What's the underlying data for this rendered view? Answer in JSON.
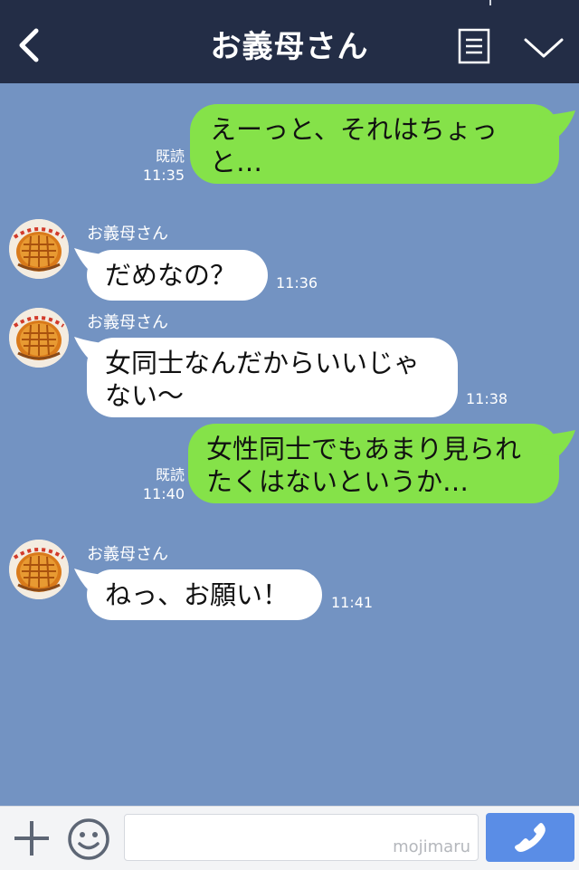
{
  "header": {
    "title": "お義母さん",
    "icons": {
      "back": "chevron-left-icon",
      "menu": "list-menu-icon",
      "more": "chevron-down-icon"
    }
  },
  "contact": {
    "name": "お義母さん",
    "avatar": "pie-avatar-icon"
  },
  "messages": [
    {
      "direction": "outgoing",
      "text": "えーっと、それはちょっと…",
      "read": "既読",
      "time": "11:35"
    },
    {
      "direction": "incoming",
      "sender": "お義母さん",
      "text": "だめなの？",
      "time": "11:36"
    },
    {
      "direction": "incoming",
      "sender": "お義母さん",
      "text": "女同士なんだからいいじゃない〜",
      "time": "11:38"
    },
    {
      "direction": "outgoing",
      "text": "女性同士でもあまり見られたくはないというか…",
      "read": "既読",
      "time": "11:40"
    },
    {
      "direction": "incoming",
      "sender": "お義母さん",
      "text": "ねっ、お願い！",
      "time": "11:41"
    }
  ],
  "input_bar": {
    "placeholder": "",
    "watermark": "mojimaru",
    "icons": {
      "add": "plus-icon",
      "emoji": "smiley-icon",
      "call": "phone-icon"
    }
  },
  "colors": {
    "header_bg": "#232d46",
    "chat_bg": "#7393c2",
    "outgoing_bubble": "#85e249",
    "incoming_bubble": "#ffffff",
    "call_button": "#5a8de6"
  }
}
